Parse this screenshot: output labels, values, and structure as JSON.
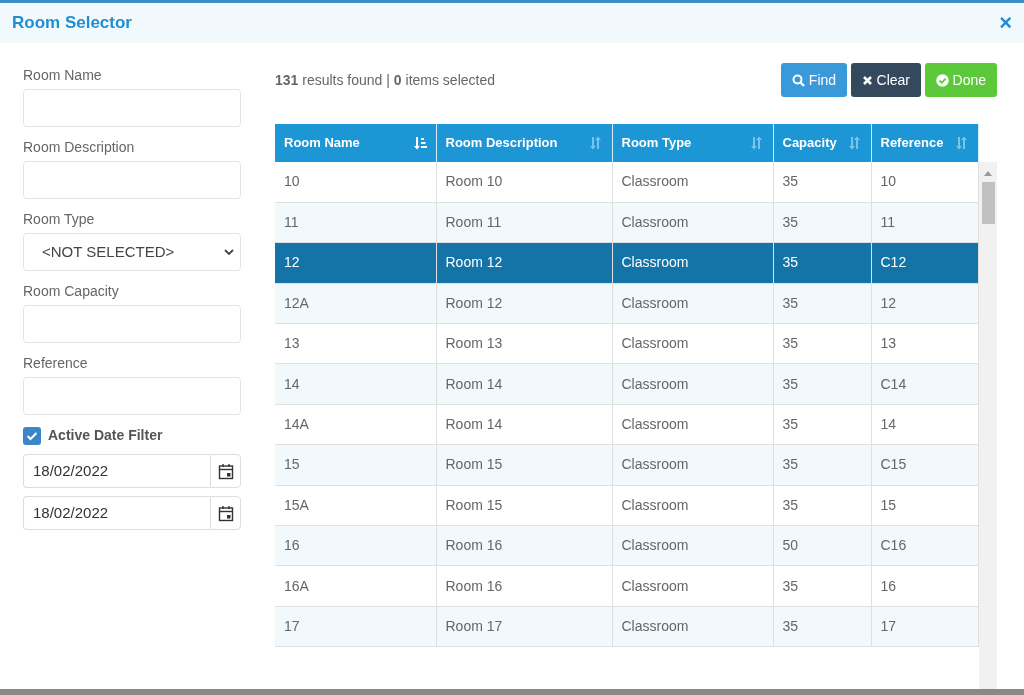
{
  "window": {
    "title": "Room Selector",
    "close": "×"
  },
  "filters": [
    {
      "kind": "text",
      "label": "Room Name"
    },
    {
      "kind": "text",
      "label": "Room Description"
    },
    {
      "kind": "select",
      "label": "Room Type",
      "value": "<NOT SELECTED>"
    },
    {
      "kind": "text",
      "label": "Room Capacity"
    },
    {
      "kind": "text",
      "label": "Reference"
    }
  ],
  "date_filter": {
    "label": "Active Date Filter",
    "checked": true,
    "dates": [
      "18/02/2022",
      "18/02/2022"
    ]
  },
  "summary": "**131** results found | **0** items selected",
  "buttons": [
    {
      "kind": "find",
      "label": "Find"
    },
    {
      "kind": "clear",
      "label": "Clear"
    },
    {
      "kind": "done",
      "label": "Done"
    }
  ],
  "table": {
    "columns": [
      {
        "label": "Room Name",
        "sorted": true
      },
      {
        "label": "Room Description",
        "sorted": false
      },
      {
        "label": "Room Type",
        "sorted": false
      },
      {
        "label": "Capacity",
        "sorted": false
      },
      {
        "label": "Reference",
        "sorted": false
      }
    ],
    "rows": [
      {
        "cells": [
          "10",
          "Room 10",
          "Classroom",
          "35",
          "10"
        ],
        "selected": false
      },
      {
        "cells": [
          "11",
          "Room 11",
          "Classroom",
          "35",
          "11"
        ],
        "selected": false
      },
      {
        "cells": [
          "12",
          "Room 12",
          "Classroom",
          "35",
          "C12"
        ],
        "selected": true
      },
      {
        "cells": [
          "12A",
          "Room 12",
          "Classroom",
          "35",
          "12"
        ],
        "selected": false
      },
      {
        "cells": [
          "13",
          "Room 13",
          "Classroom",
          "35",
          "13"
        ],
        "selected": false
      },
      {
        "cells": [
          "14",
          "Room 14",
          "Classroom",
          "35",
          "C14"
        ],
        "selected": false
      },
      {
        "cells": [
          "14A",
          "Room 14",
          "Classroom",
          "35",
          "14"
        ],
        "selected": false
      },
      {
        "cells": [
          "15",
          "Room 15",
          "Classroom",
          "35",
          "C15"
        ],
        "selected": false
      },
      {
        "cells": [
          "15A",
          "Room 15",
          "Classroom",
          "35",
          "15"
        ],
        "selected": false
      },
      {
        "cells": [
          "16",
          "Room 16",
          "Classroom",
          "50",
          "C16"
        ],
        "selected": false
      },
      {
        "cells": [
          "16A",
          "Room 16",
          "Classroom",
          "35",
          "16"
        ],
        "selected": false
      },
      {
        "cells": [
          "17",
          "Room 17",
          "Classroom",
          "35",
          "17"
        ],
        "selected": false
      }
    ]
  }
}
